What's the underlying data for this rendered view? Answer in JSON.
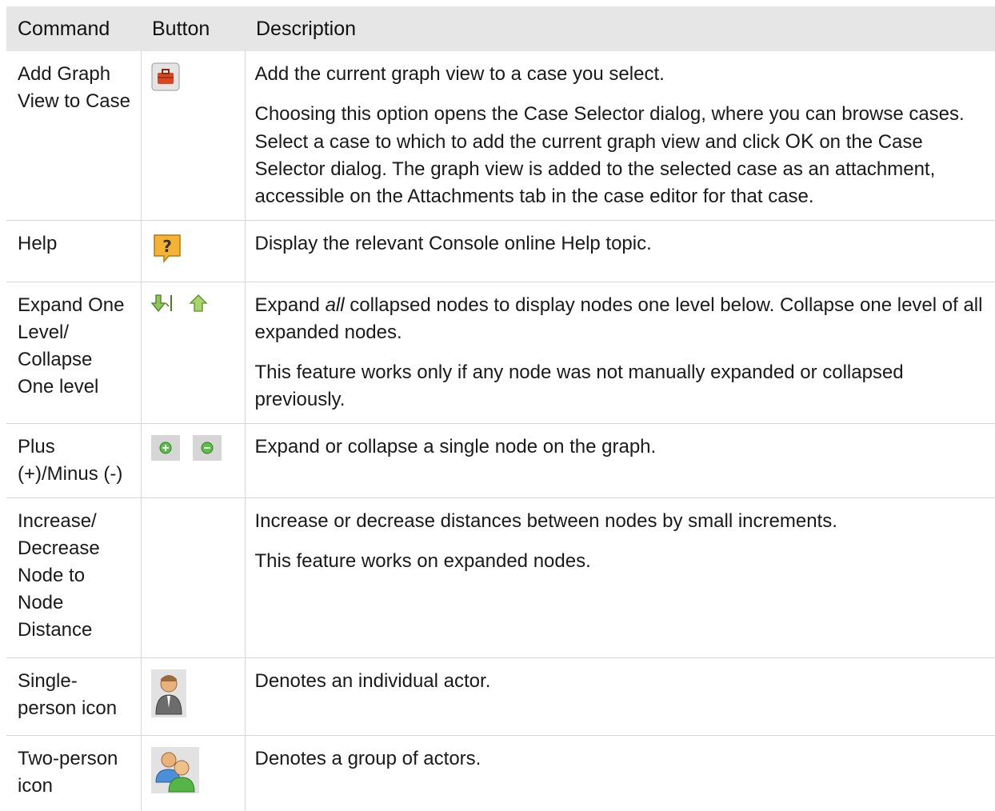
{
  "headers": {
    "command": "Command",
    "button": "Button",
    "description": "Description"
  },
  "rows": [
    {
      "command": "Add Graph View to Case",
      "icons": [
        "briefcase-icon"
      ],
      "desc1": "Add the current graph view to a case you select.",
      "desc2a": "Choosing this option opens the Case Selector dialog, where you can browse cases. Select a case to which to add the current graph view and click ",
      "desc2b": "OK",
      "desc2c": " on the Case Selector dialog. The graph view is added to the selected case as an attachment, accessible on the Attachments tab in the case editor for that case."
    },
    {
      "command": "Help",
      "icons": [
        "help-icon"
      ],
      "desc1": "Display the relevant Console online Help topic."
    },
    {
      "command": "Expand One Level/ Collapse One level",
      "icons": [
        "expand-one-level-icon",
        "collapse-one-level-icon"
      ],
      "desc1a": "Expand ",
      "desc1b": "all",
      "desc1c": " collapsed nodes to display nodes one level below. Collapse one level of all expanded nodes.",
      "desc2": "This feature works only if any node was not manually expanded or collapsed previously."
    },
    {
      "command": "Plus (+)/Minus (-)",
      "icons": [
        "plus-icon",
        "minus-icon"
      ],
      "desc1": "Expand or collapse a single node on the graph."
    },
    {
      "command": "Increase/ Decrease Node to Node Distance",
      "icons": [],
      "desc1": "Increase or decrease distances between nodes by small increments.",
      "desc2": "This feature works on expanded nodes."
    },
    {
      "command": "Single-person icon",
      "icons": [
        "single-person-icon"
      ],
      "desc1": "Denotes an individual actor."
    },
    {
      "command": "Two-person icon",
      "icons": [
        "two-person-icon"
      ],
      "desc1": "Denotes a group of actors."
    }
  ]
}
